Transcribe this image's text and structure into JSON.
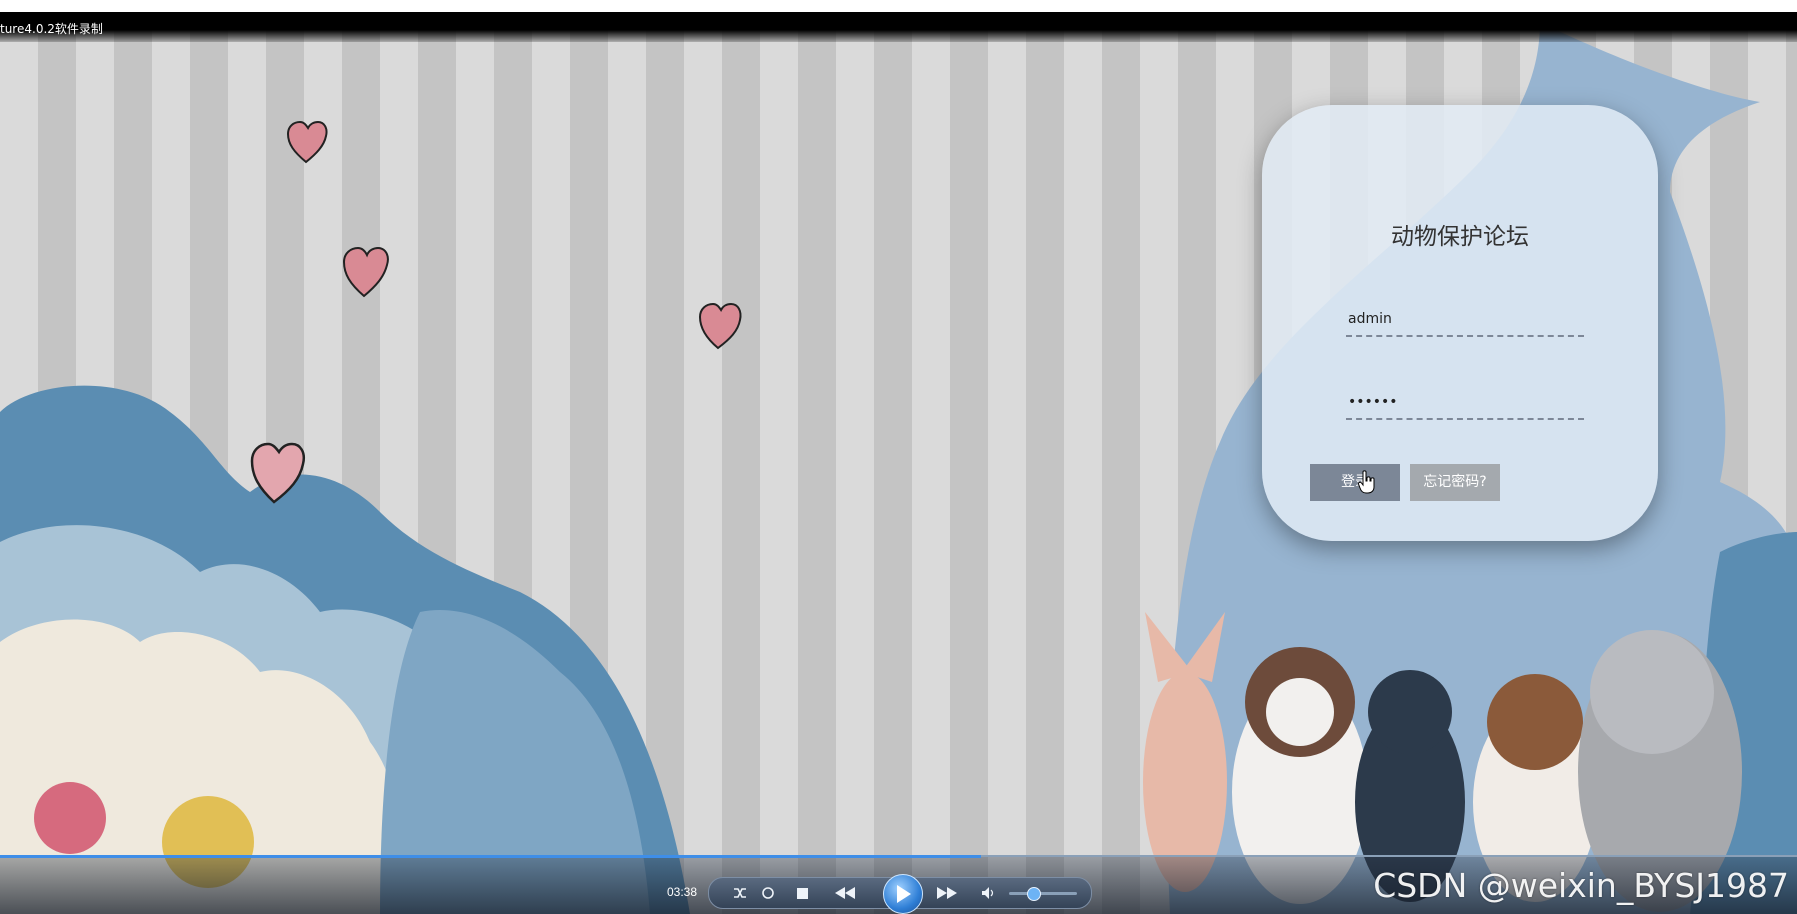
{
  "recorder": {
    "title": "ture4.0.2软件录制"
  },
  "login": {
    "site_title": "动物保护论坛",
    "username_value": "admin",
    "password_masked": "••••••",
    "login_button": "登录",
    "forgot_button": "忘记密码?"
  },
  "player": {
    "time": "03:38",
    "progress_fraction": 0.546,
    "volume_fraction": 0.35
  },
  "watermark": "CSDN @weixin_BYSJ1987",
  "colors": {
    "cloud_dark": "#5b8db2",
    "cloud_light": "#a8c3d6",
    "cloud_cream": "#efe9dd",
    "accent_blue": "#3e8ee8",
    "login_button": "#7c8797",
    "forgot_button": "#a4a9ae"
  }
}
